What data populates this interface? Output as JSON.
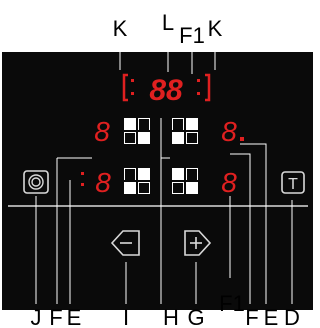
{
  "callouts": {
    "top": {
      "k_left": "K",
      "l": "L",
      "f1": "F1",
      "k_right": "K"
    },
    "bottom": {
      "j": "J",
      "f_left": "F",
      "e_left": "E",
      "i": "I",
      "h": "H",
      "g": "G",
      "f1": "F1",
      "f_right": "F",
      "e_right": "E",
      "d": "D"
    }
  },
  "panel": {
    "top_display_text": "88",
    "zone_digit": "8",
    "timer_button_label": "T",
    "power_icon": "hob-power-icon",
    "zone_icon": "cooking-zone-icon",
    "minus_icon": "minus-arrow-icon",
    "plus_icon": "plus-arrow-icon"
  },
  "colors": {
    "panel_bg": "#0a0a0a",
    "led_red": "#e02020",
    "panel_fg": "#d9d9d9",
    "page_bg": "#ffffff",
    "label_text": "#000000"
  }
}
